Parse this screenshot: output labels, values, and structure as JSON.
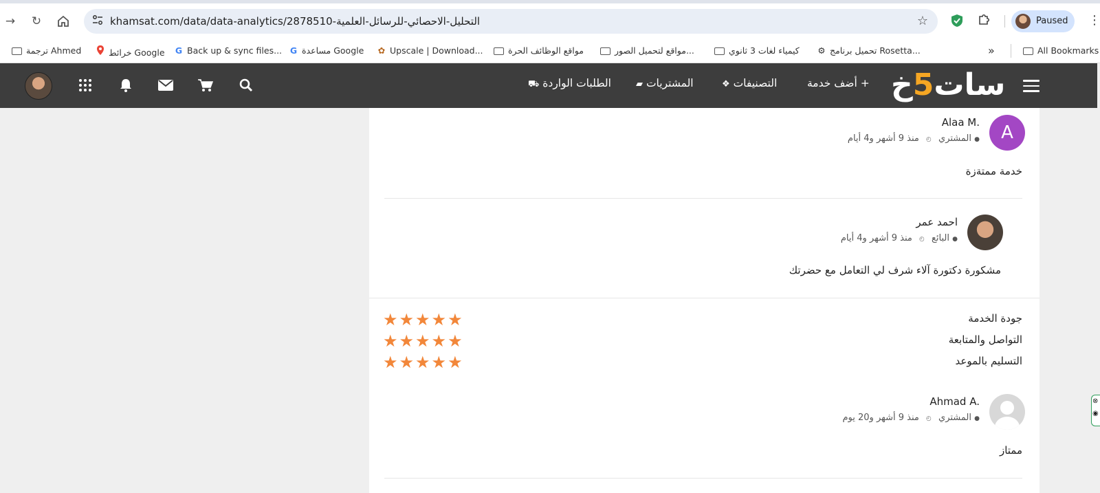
{
  "browser": {
    "url": "khamsat.com/data/data-analytics/2878510-التحليل-الاحصائي-للرسائل-العلمية",
    "profile_label": "Paused",
    "icons": {
      "forward": "forward-arrow-icon",
      "reload": "reload-icon",
      "home": "home-icon",
      "site_settings": "tune-icon",
      "bookmark_star": "star-icon",
      "extension_shield": "shield-icon",
      "extensions": "puzzle-icon",
      "menu": "kebab-menu-icon"
    },
    "bookmarks": [
      {
        "label": "ترجمة Ahmed",
        "icon": "folder-icon"
      },
      {
        "label": "خرائط Google",
        "icon": "maps-pin-icon"
      },
      {
        "label": "Back up & sync files...",
        "icon": "google-icon"
      },
      {
        "label": "مساعدة Google",
        "icon": "google-icon"
      },
      {
        "label": "Upscale | Download...",
        "icon": "upscale-icon"
      },
      {
        "label": "مواقع الوظائف الحرة",
        "icon": "folder-icon"
      },
      {
        "label": "مواقع لتحميل الصور...",
        "icon": "folder-icon"
      },
      {
        "label": "كيمياء لغات 3 ثانوي",
        "icon": "folder-icon"
      },
      {
        "label": "تحميل برنامج Rosetta...",
        "icon": "rosetta-icon"
      }
    ],
    "overflow": "»",
    "all_bookmarks": "All Bookmarks"
  },
  "site": {
    "logo_parts": {
      "left": "خ",
      "five": "5",
      "right": "سات"
    },
    "nav": {
      "add_service": "+ أضف خدمة",
      "categories": "التصنيفات",
      "purchases": "المشتريات",
      "incoming_orders": "الطلبات الواردة"
    },
    "icons": {
      "search": "search-icon",
      "cart": "cart-icon",
      "mail": "mail-icon",
      "bell": "bell-icon",
      "apps": "apps-grid-icon",
      "menu": "hamburger-icon"
    }
  },
  "reviews": [
    {
      "avatar_letter": "A",
      "name": "Alaa M.",
      "role": "المشتري",
      "time": "منذ 9 أشهر و4 أيام",
      "comment": "خدمة ممتةزة"
    },
    {
      "name": "احمد عمر",
      "role": "البائع",
      "time": "منذ 9 أشهر و4 أيام",
      "comment": "مشكورة دكتورة آلاء شرف لي التعامل مع حضرتك"
    }
  ],
  "ratings": [
    {
      "label": "جودة الخدمة",
      "stars": 5
    },
    {
      "label": "التواصل والمتابعة",
      "stars": 5
    },
    {
      "label": "التسليم بالموعد",
      "stars": 5
    }
  ],
  "review3": {
    "name": "Ahmad A.",
    "role": "المشتري",
    "time": "منذ 9 أشهر و20 يوم",
    "comment": "ممتاز"
  },
  "colors": {
    "header_bg": "#3d3d3d",
    "logo_accent": "#f5a623",
    "star": "#f2873a",
    "avatar_purple": "#a347c4"
  }
}
